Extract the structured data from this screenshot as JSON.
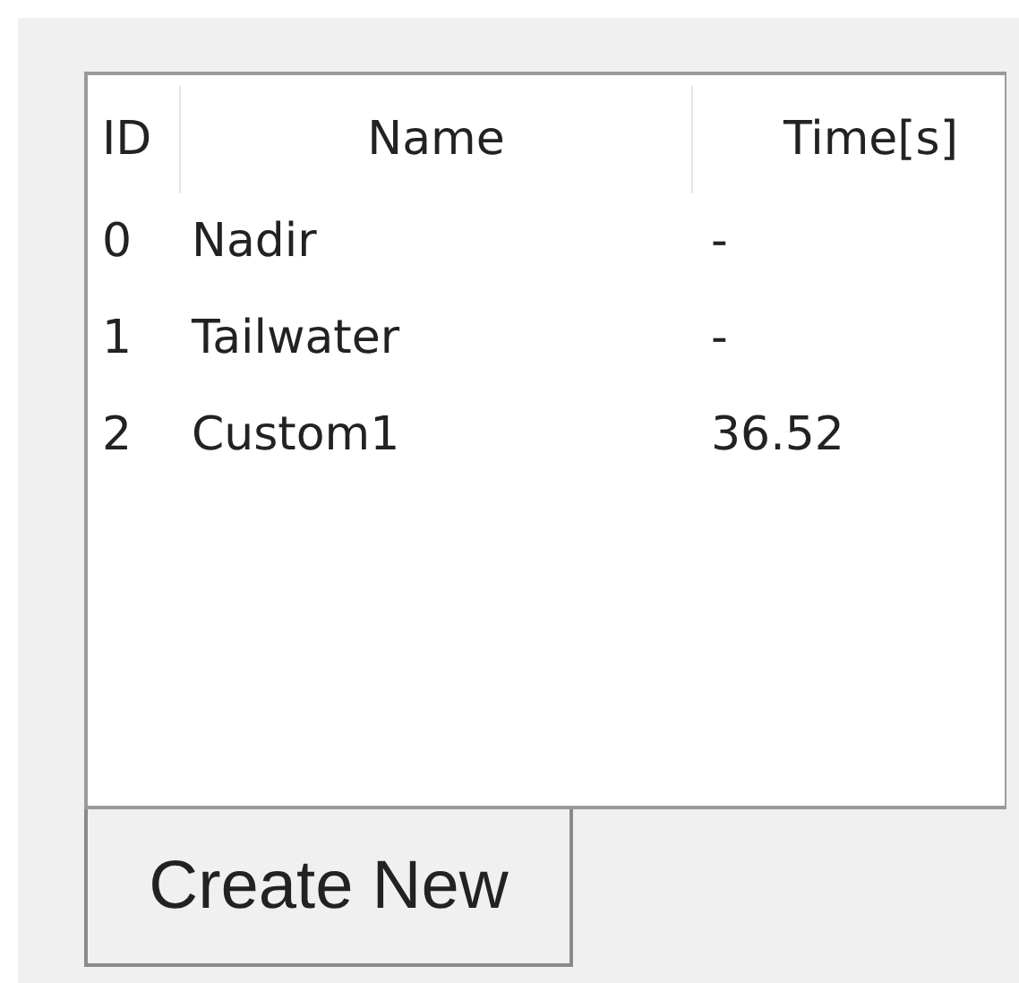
{
  "table": {
    "columns": [
      "ID",
      "Name",
      "Time[s]"
    ],
    "rows": [
      [
        "0",
        "Nadir",
        "-"
      ],
      [
        "1",
        "Tailwater",
        "-"
      ],
      [
        "2",
        "Custom1",
        "36.52"
      ]
    ]
  },
  "buttons": [
    "Create New"
  ]
}
